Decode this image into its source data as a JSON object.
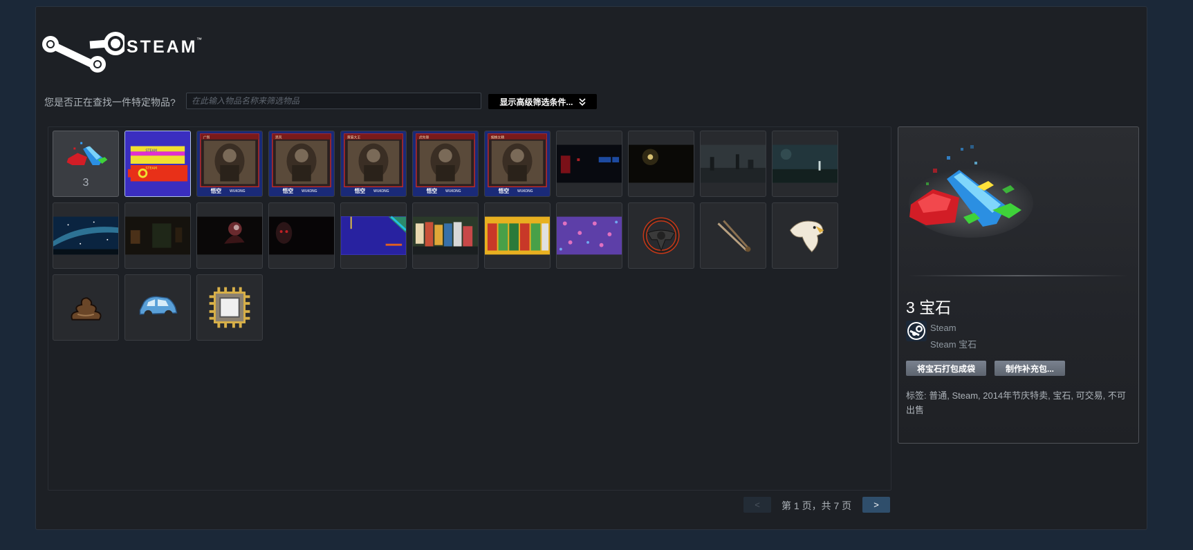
{
  "header": {
    "logo_text": "STEAM",
    "logo_tm": "™"
  },
  "search": {
    "label": "您是否正在查找一件特定物品?",
    "placeholder": "在此输入物品名称来筛选物品",
    "value": "",
    "advanced_button": "显示高级筛选条件..."
  },
  "inventory": {
    "items": [
      {
        "kind": "gems",
        "count": "3",
        "state": "active"
      },
      {
        "kind": "steam-banner",
        "state": "selected"
      },
      {
        "kind": "wukong-card",
        "caption": "广智"
      },
      {
        "kind": "wukong-card",
        "caption": "黑风"
      },
      {
        "kind": "wukong-card",
        "caption": "黄眉大王"
      },
      {
        "kind": "wukong-card",
        "caption": "虎先锋"
      },
      {
        "kind": "wukong-card",
        "caption": "蜘蛛女精"
      },
      {
        "kind": "background",
        "scene": "red-lights"
      },
      {
        "kind": "background",
        "scene": "dark-lamp"
      },
      {
        "kind": "background",
        "scene": "misty-ruins"
      },
      {
        "kind": "background",
        "scene": "teal-field"
      },
      {
        "kind": "background",
        "scene": "starry-night"
      },
      {
        "kind": "background",
        "scene": "dark-corridor"
      },
      {
        "kind": "background",
        "scene": "red-figure"
      },
      {
        "kind": "background",
        "scene": "hooded-face"
      },
      {
        "kind": "background",
        "scene": "blue-grid"
      },
      {
        "kind": "background",
        "scene": "party-crowd"
      },
      {
        "kind": "background",
        "scene": "costume-lineup"
      },
      {
        "kind": "background",
        "scene": "purple-pattern"
      },
      {
        "kind": "emoticon",
        "icon": "steering-wheel-icon"
      },
      {
        "kind": "emoticon",
        "icon": "tongs-icon"
      },
      {
        "kind": "emoticon",
        "icon": "eagle-icon"
      },
      {
        "kind": "emoticon",
        "icon": "poop-icon"
      },
      {
        "kind": "emoticon",
        "icon": "car-icon"
      },
      {
        "kind": "emoticon",
        "icon": "chip-icon"
      }
    ]
  },
  "pagination": {
    "prev": "<",
    "text": "第 1 页，共 7 页",
    "next": ">"
  },
  "detail": {
    "title": "3 宝石",
    "game": "Steam",
    "type": "Steam 宝石",
    "button1": "将宝石打包成袋",
    "button2": "制作补充包...",
    "tags": "标签: 普通, Steam, 2014年节庆特卖, 宝石, 可交易, 不可出售"
  }
}
